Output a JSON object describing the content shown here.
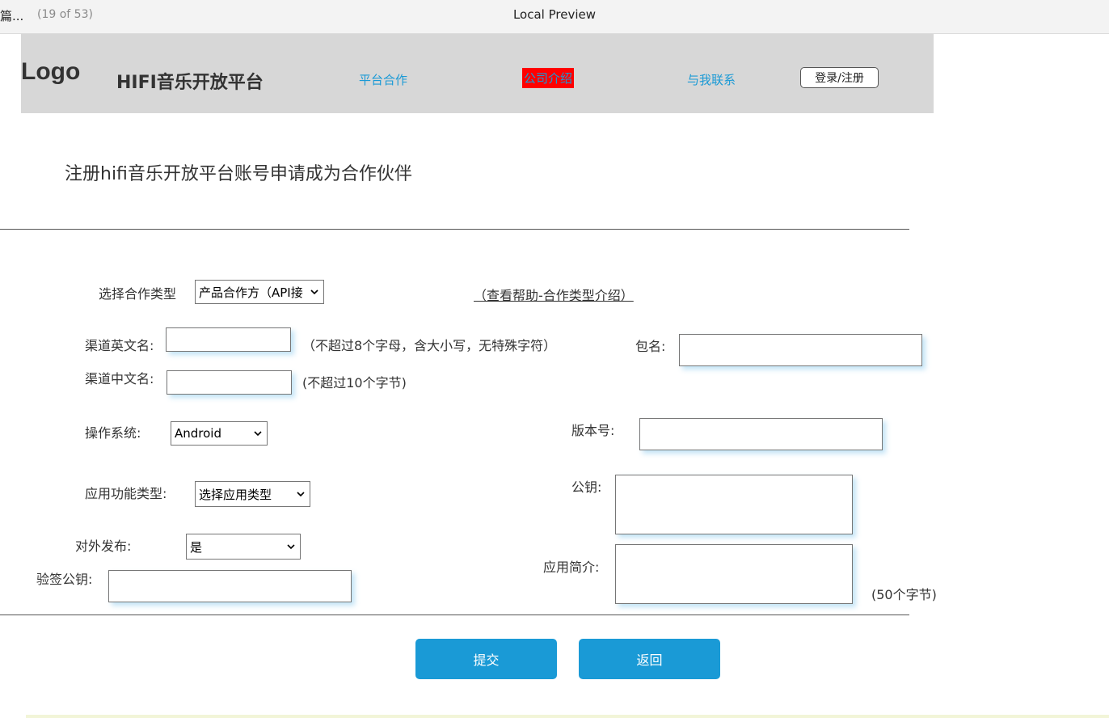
{
  "window": {
    "left_fragment": "篇...",
    "count": "(19 of 53)",
    "title": "Local Preview"
  },
  "header": {
    "logo": "Logo",
    "brand": "HIFI音乐开放平台",
    "nav": [
      "平台合作",
      "公司介绍",
      "与我联系"
    ],
    "login": "登录/注册"
  },
  "page_title": "注册hifi音乐开放平台账号申请成为合作伙伴",
  "form": {
    "coop_type": {
      "label": "选择合作类型",
      "value": "产品合作方（API接",
      "help": "（查看帮助-合作类型介绍）"
    },
    "channel_en": {
      "label": "渠道英文名:",
      "hint": "（不超过8个字母，含大小写，无特殊字符）"
    },
    "package": {
      "label": "包名:"
    },
    "channel_cn": {
      "label": "渠道中文名:",
      "hint": "(不超过10个字节)"
    },
    "os": {
      "label": "操作系统:",
      "value": "Android"
    },
    "version": {
      "label": "版本号:"
    },
    "app_type": {
      "label": "应用功能类型:",
      "value": "选择应用类型"
    },
    "public_key": {
      "label": "公钥:"
    },
    "publish": {
      "label": "对外发布:",
      "value": "是"
    },
    "verify_key": {
      "label": "验签公钥:"
    },
    "intro": {
      "label": "应用简介:",
      "hint": "(50个字节)"
    }
  },
  "buttons": {
    "submit": "提交",
    "back": "返回"
  },
  "colors": {
    "accent": "#1a9ad6",
    "highlight": "#ff0000",
    "header_bg": "#d7d7d7"
  }
}
